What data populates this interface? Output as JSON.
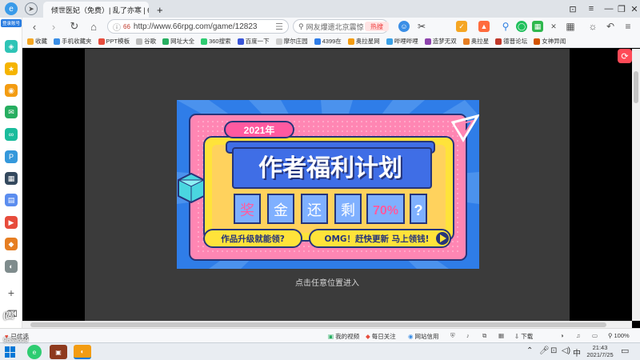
{
  "tabs": [
    {
      "title": "倾世医妃（免费）| 乱了亦寒 | 6"
    },
    {
      "title": "+"
    }
  ],
  "window_controls": [
    "⊡",
    "≡",
    "—",
    "❐",
    "✕"
  ],
  "nav": {
    "url": "http://www.66rpg.com/game/12823",
    "search_placeholder": "网友爆遗北京震惊",
    "hot_badge": "热搜"
  },
  "bookmarks": [
    "收藏",
    "手机收藏夹",
    "PPT模板",
    "谷歌",
    "网址大全",
    "360搜索",
    "百度一下",
    "摩尔庄园",
    "4399在",
    "奥拉星网",
    "哔哩哔哩",
    "造梦无双",
    "奥拉星",
    "德普论坛",
    "女神异闻"
  ],
  "sidebar_badge": "登录账号",
  "banner": {
    "year": "2021年",
    "title": "作者福利计划",
    "chars": [
      "奖",
      "金",
      "还",
      "剩",
      "70%",
      "?"
    ],
    "left_pill": "作品升级就能领?",
    "right_pill": "OMG！赶快更新 马上领钱!",
    "colors": {
      "bg": "#2f7de8",
      "pink": "#ff86b3",
      "yellow": "#ffe33a",
      "blue": "#3f6ee6",
      "cyan": "#4ad6e0"
    }
  },
  "game_caption": "点击任意位置进入",
  "status": {
    "left": "已优选",
    "items": [
      "我的视频",
      "每日关注",
      "网站信用",
      "下载",
      "100%"
    ]
  },
  "overlay": {
    "id_text": "(固",
    "num_text": "9639669"
  },
  "taskbar": {
    "time": "21:43",
    "date": "2021/7/25",
    "ime": "中"
  }
}
